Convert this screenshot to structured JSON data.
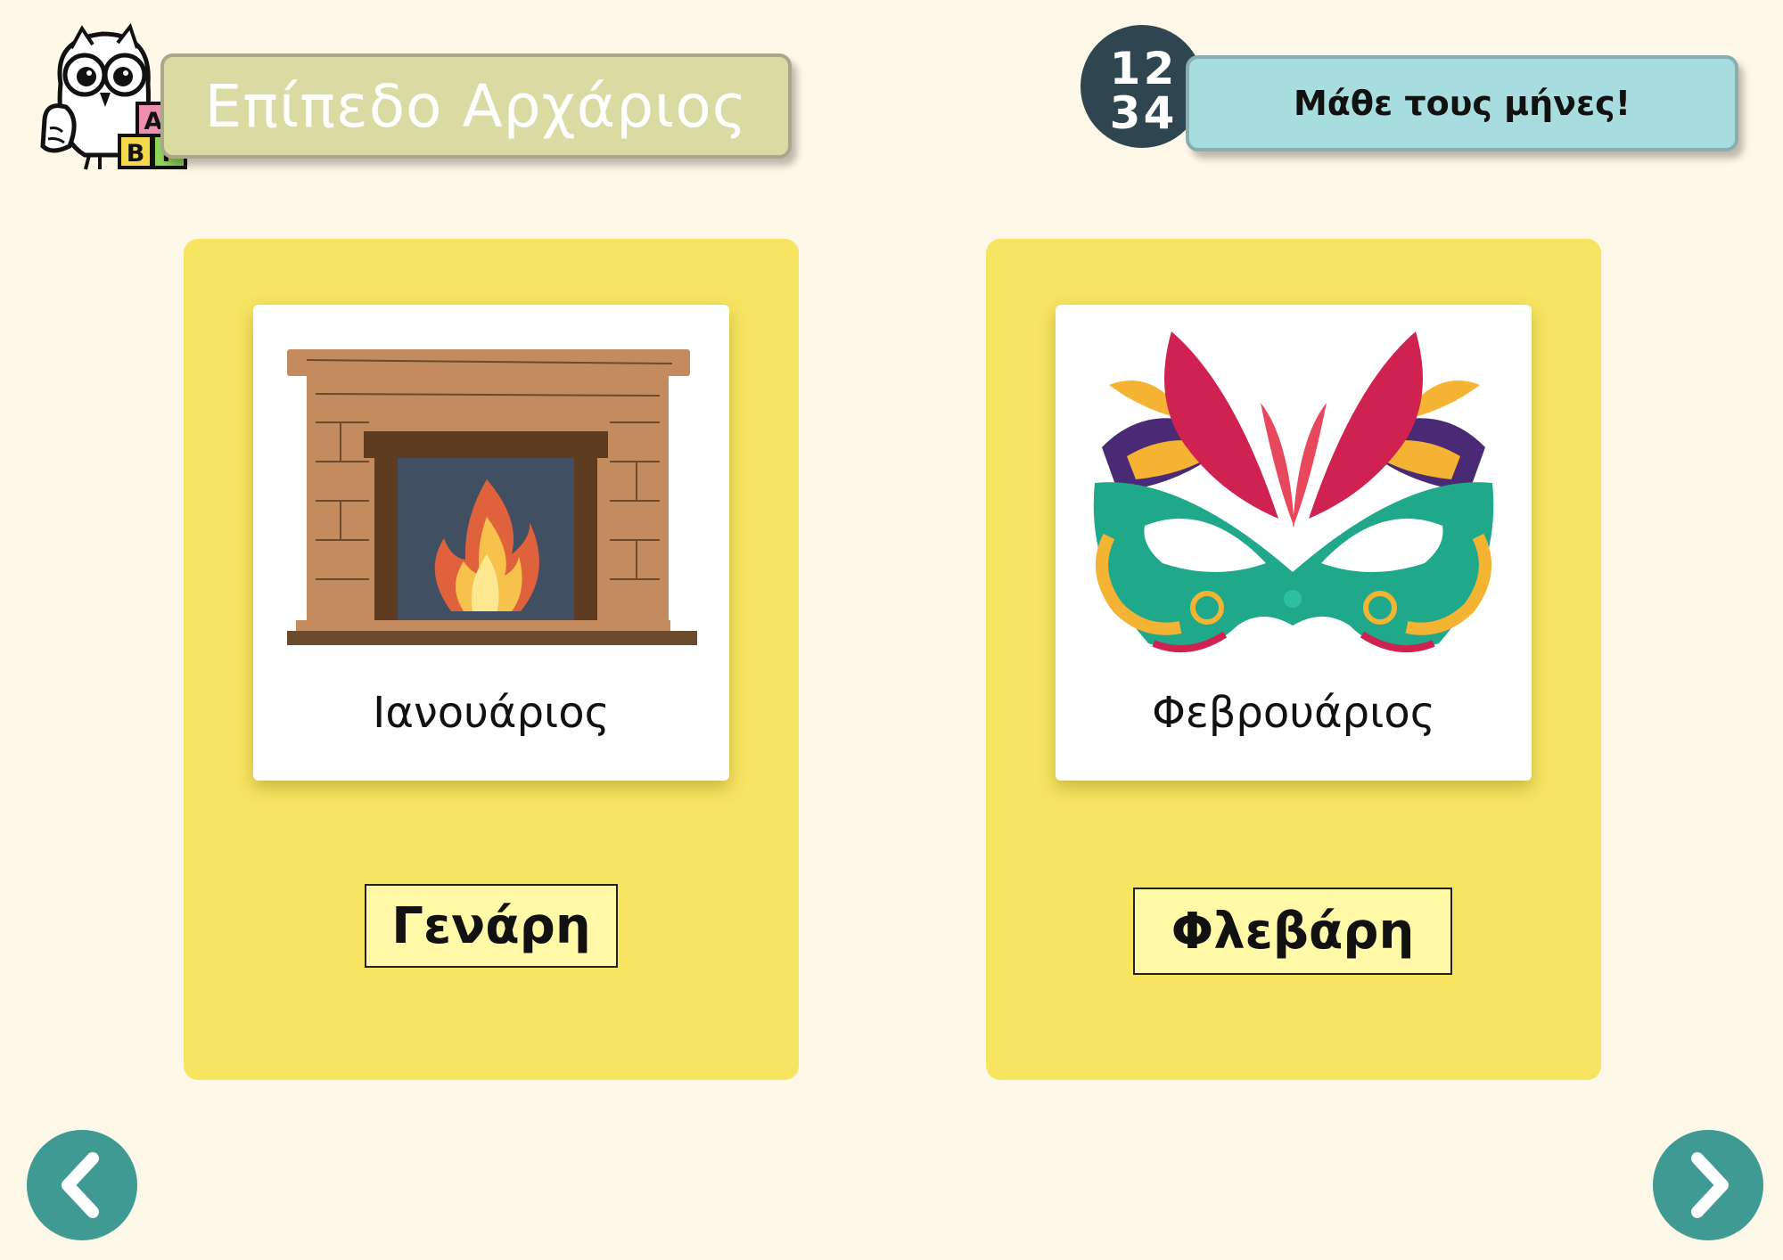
{
  "header": {
    "level_title": "Επίπεδο Αρχάριος",
    "topic_title": "Μάθε τους μήνες!",
    "logo_blocks": [
      "A",
      "B",
      "Γ"
    ],
    "badge_digits": [
      "1",
      "2",
      "3",
      "4"
    ]
  },
  "cards": [
    {
      "image_icon": "fireplace-icon",
      "month": "Ιανουάριος",
      "folk_name": "Γενάρη"
    },
    {
      "image_icon": "carnival-mask-icon",
      "month": "Φεβρουάριος",
      "folk_name": "Φλεβάρη"
    }
  ],
  "navigation": {
    "prev_icon": "chevron-left-icon",
    "next_icon": "chevron-right-icon"
  },
  "colors": {
    "background": "#fdf8e8",
    "card": "#f7e461",
    "level_banner": "#d9dba3",
    "topic_banner": "#a8dde0",
    "nav_button": "#3f9a94",
    "badge": "#2f4650",
    "folk_button": "#fff9a8"
  }
}
